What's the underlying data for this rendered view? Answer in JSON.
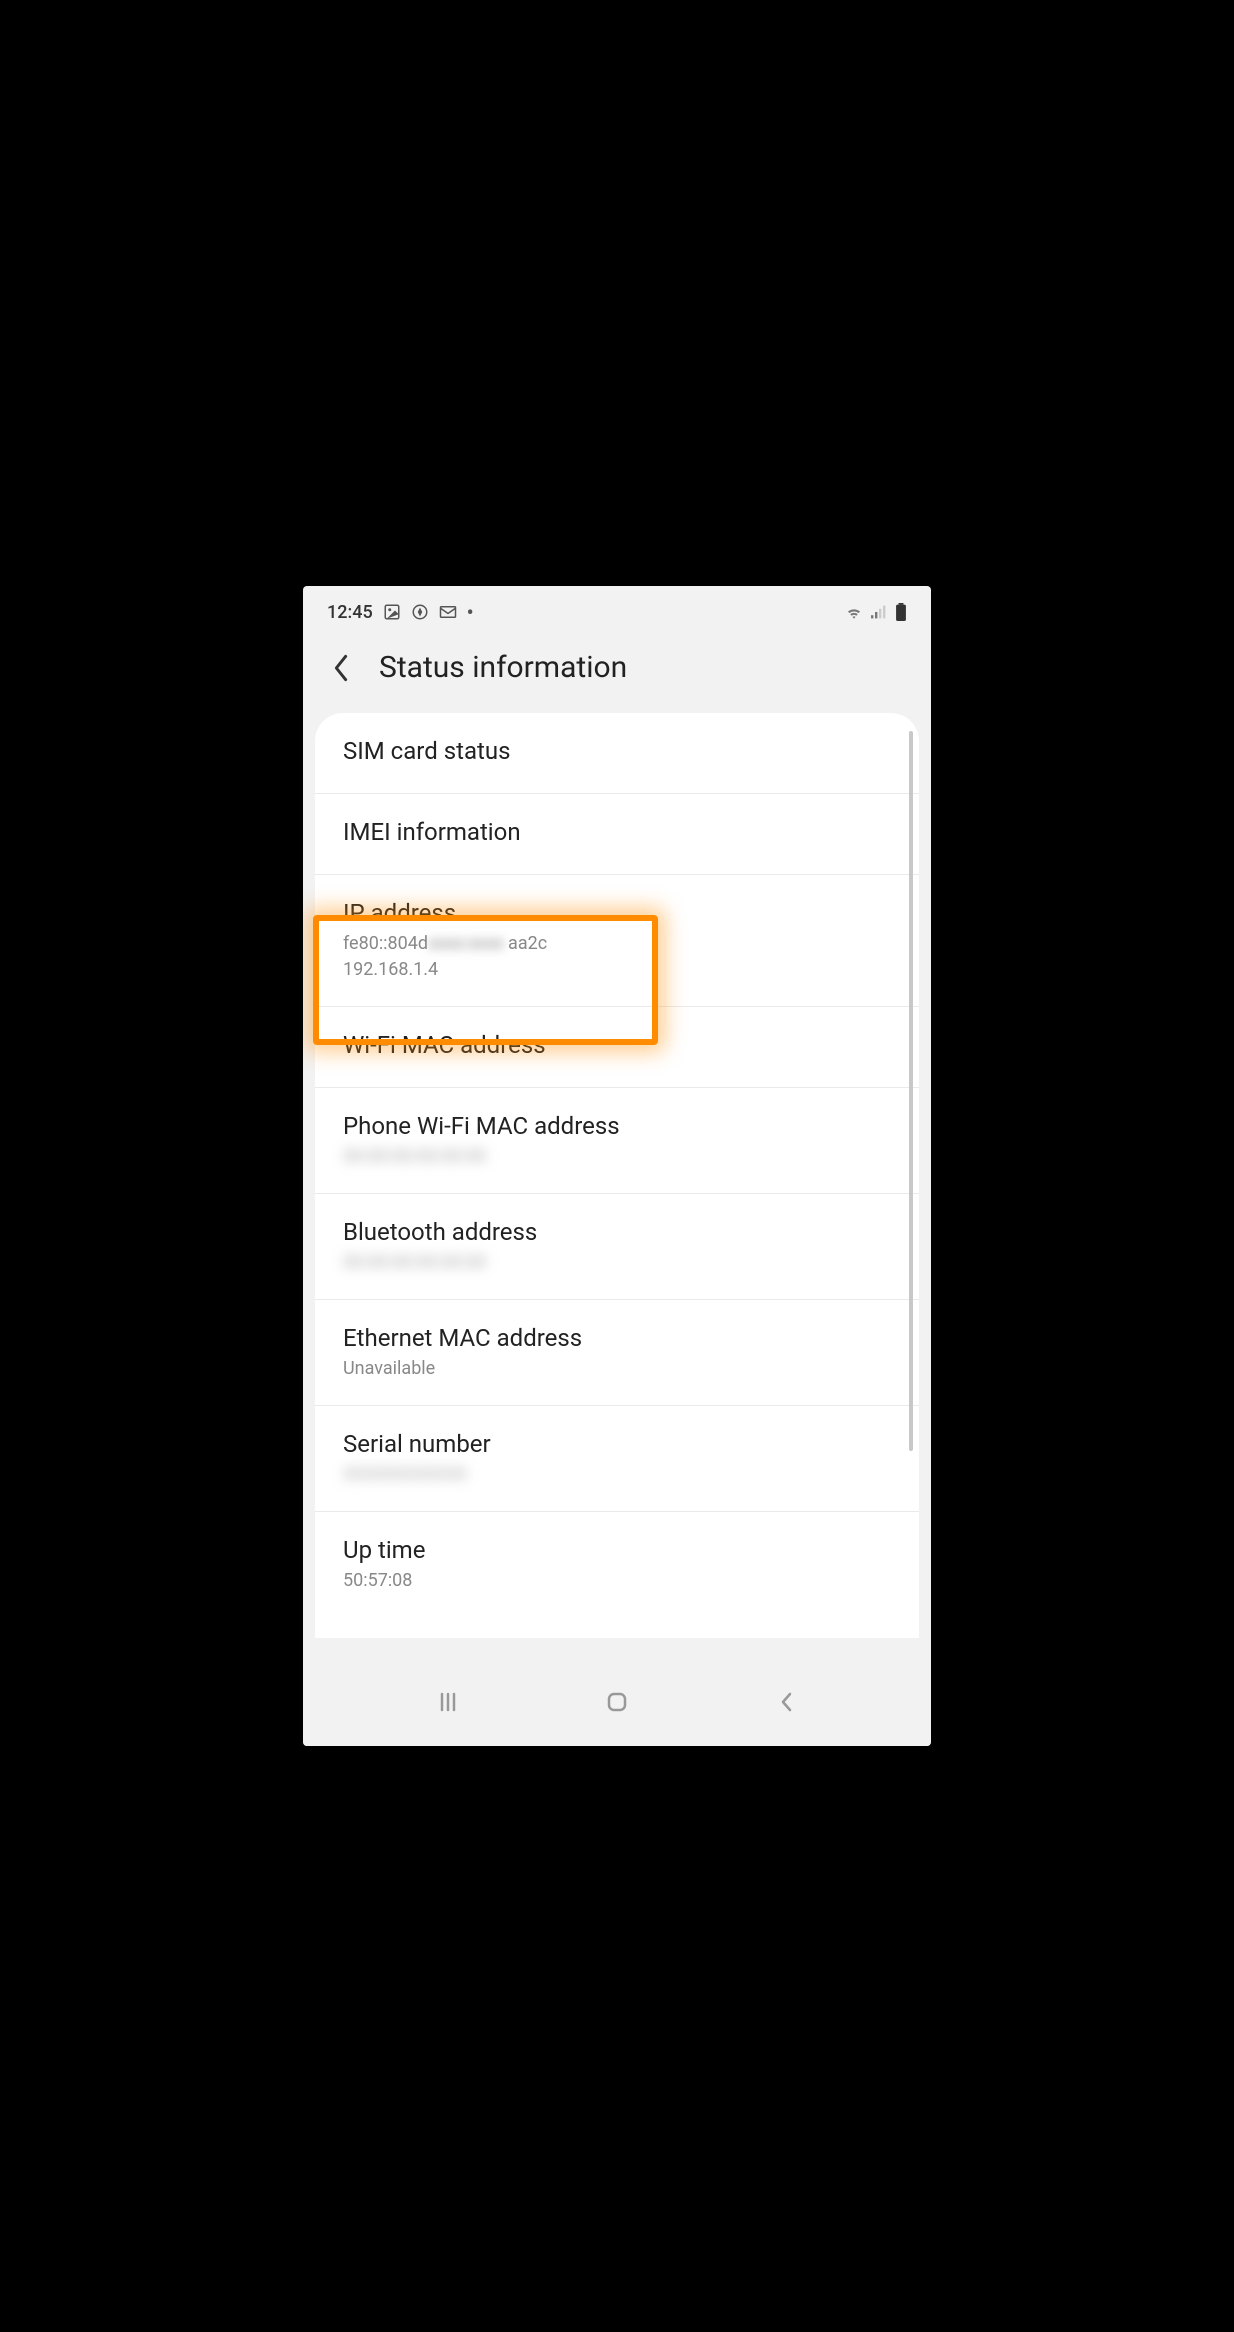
{
  "status_bar": {
    "time": "12:45",
    "icons_left": [
      "image-icon",
      "avast-icon",
      "gmail-icon",
      "more-icon"
    ],
    "icons_right": [
      "wifi-icon",
      "signal-icon",
      "battery-icon"
    ]
  },
  "header": {
    "title": "Status information"
  },
  "items": [
    {
      "title": "SIM card status",
      "value": null,
      "blurred": false
    },
    {
      "title": "IMEI information",
      "value": null,
      "blurred": false
    },
    {
      "title": "IP address",
      "value_line1_prefix": "fe80::804d",
      "value_line1_suffix": "aa2c",
      "value_line2": "192.168.1.4",
      "highlighted": true
    },
    {
      "title": "Wi-Fi MAC address",
      "value": null,
      "blurred": false
    },
    {
      "title": "Phone Wi-Fi MAC address",
      "value": "00:00:00:00:00:00",
      "blurred": true
    },
    {
      "title": "Bluetooth address",
      "value": "00:00:00:00:00:00",
      "blurred": true
    },
    {
      "title": "Ethernet MAC address",
      "value": "Unavailable",
      "blurred": false
    },
    {
      "title": "Serial number",
      "value": "XXXXXXXXXXX",
      "blurred": true
    },
    {
      "title": "Up time",
      "value": "50:57:08",
      "blurred": false
    }
  ],
  "highlight_color": "#ff8c00"
}
